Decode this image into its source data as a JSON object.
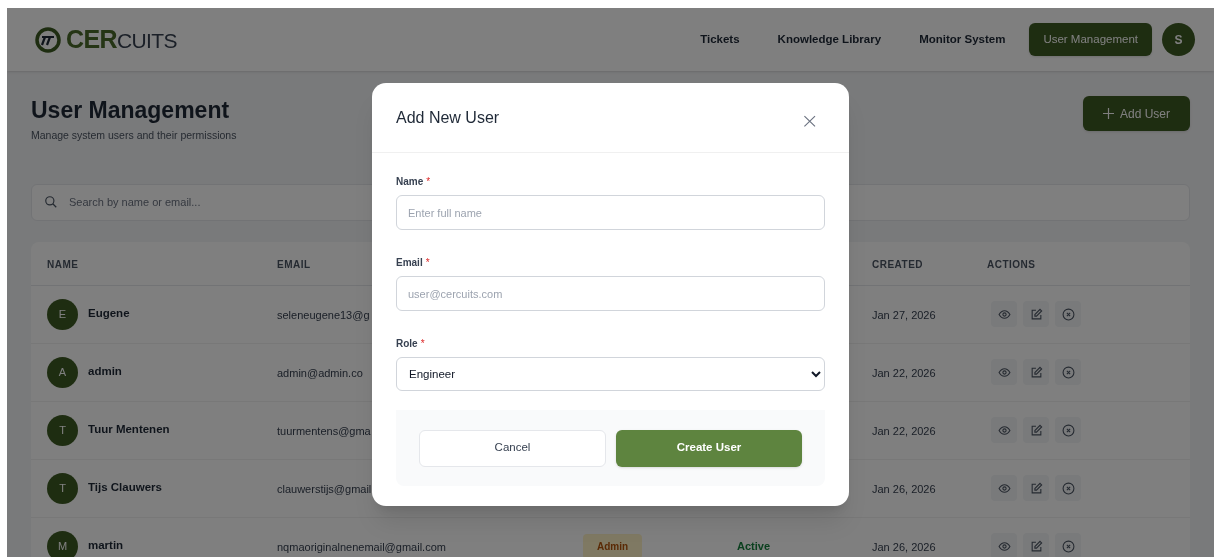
{
  "header": {
    "logo": {
      "strong": "CER",
      "rest": "CUITS"
    },
    "nav": [
      {
        "label": "Tickets",
        "selected": false
      },
      {
        "label": "Knowledge Library",
        "selected": false
      },
      {
        "label": "Monitor System",
        "selected": false
      },
      {
        "label": "User Management",
        "selected": true
      }
    ],
    "avatar": "S"
  },
  "page": {
    "title": "User Management",
    "subtitle": "Manage system users and their permissions",
    "add_button": "Add User",
    "search": {
      "placeholder": "Search by name or email..."
    }
  },
  "table": {
    "columns": [
      {
        "label": "NAME"
      },
      {
        "label": "EMAIL"
      },
      {
        "label": "CREATED"
      },
      {
        "label": "ACTIONS"
      }
    ],
    "rows": [
      {
        "initial": "E",
        "name": "Eugene",
        "email": "seleneugene13@g",
        "created": "Jan 27, 2026"
      },
      {
        "initial": "A",
        "name": "admin",
        "email": "admin@admin.co",
        "created": "Jan 22, 2026"
      },
      {
        "initial": "T",
        "name": "Tuur Mentenen",
        "email": "tuurmentens@gma",
        "created": "Jan 22, 2026"
      },
      {
        "initial": "T",
        "name": "Tijs Clauwers",
        "email": "clauwerstijs@gmail",
        "created": "Jan 26, 2026"
      },
      {
        "initial": "M",
        "name": "martin",
        "email": "nqmaoriginalnenemail@gmail.com",
        "role": "Admin",
        "status": "Active",
        "created": "Jan 26, 2026"
      }
    ]
  },
  "modal": {
    "title": "Add New User",
    "close": "×",
    "fields": [
      {
        "kind": "text",
        "label": "Name",
        "required_mark": "*",
        "placeholder": "Enter full name"
      },
      {
        "kind": "text",
        "label": "Email",
        "required_mark": "*",
        "placeholder": "user@cercuits.com"
      },
      {
        "kind": "select",
        "label": "Role",
        "required_mark": "*",
        "value": "Engineer"
      }
    ],
    "buttons": [
      {
        "kind": "secondary",
        "label": "Cancel"
      },
      {
        "kind": "primary",
        "label": "Create User"
      }
    ]
  }
}
